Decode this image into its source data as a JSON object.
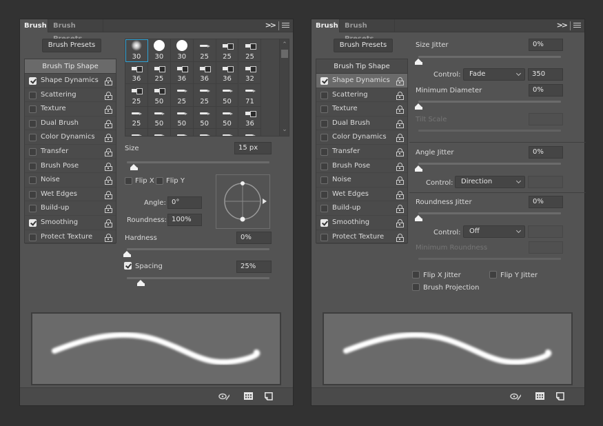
{
  "panels": [
    {
      "id": "left",
      "tabs": [
        {
          "label": "Brush",
          "active": true
        },
        {
          "label": "Brush Presets",
          "active": false
        }
      ],
      "collapse_icon": "double-chevron-right-icon",
      "menu_icon": "hamburger-menu-icon",
      "presets_button": "Brush Presets",
      "options_header": "Brush Tip Shape",
      "options_header_selected": true,
      "options": [
        {
          "label": "Shape Dynamics",
          "checked": true,
          "selected": false
        },
        {
          "label": "Scattering",
          "checked": false,
          "selected": false
        },
        {
          "label": "Texture",
          "checked": false,
          "selected": false
        },
        {
          "label": "Dual Brush",
          "checked": false,
          "selected": false
        },
        {
          "label": "Color Dynamics",
          "checked": false,
          "selected": false
        },
        {
          "label": "Transfer",
          "checked": false,
          "selected": false
        },
        {
          "label": "Brush Pose",
          "checked": false,
          "selected": false
        },
        {
          "label": "Noise",
          "checked": false,
          "selected": false
        },
        {
          "label": "Wet Edges",
          "checked": false,
          "selected": false
        },
        {
          "label": "Build-up",
          "checked": false,
          "selected": false
        },
        {
          "label": "Smoothing",
          "checked": true,
          "selected": false
        },
        {
          "label": "Protect Texture",
          "checked": false,
          "selected": false
        }
      ],
      "brush_tips": [
        {
          "size": "30",
          "kind": "soft",
          "selected": true
        },
        {
          "size": "30",
          "kind": "hard"
        },
        {
          "size": "30",
          "kind": "hard"
        },
        {
          "size": "25",
          "kind": "pen"
        },
        {
          "size": "25",
          "kind": "tool"
        },
        {
          "size": "25",
          "kind": "tool"
        },
        {
          "size": "36",
          "kind": "tool"
        },
        {
          "size": "25",
          "kind": "tool"
        },
        {
          "size": "36",
          "kind": "tool"
        },
        {
          "size": "36",
          "kind": "tool"
        },
        {
          "size": "36",
          "kind": "tool"
        },
        {
          "size": "32",
          "kind": "tool"
        },
        {
          "size": "25",
          "kind": "tool"
        },
        {
          "size": "50",
          "kind": "tool"
        },
        {
          "size": "25",
          "kind": "pen"
        },
        {
          "size": "25",
          "kind": "pen"
        },
        {
          "size": "50",
          "kind": "pen"
        },
        {
          "size": "71",
          "kind": "pen"
        },
        {
          "size": "25",
          "kind": "pen"
        },
        {
          "size": "50",
          "kind": "pen"
        },
        {
          "size": "50",
          "kind": "pen"
        },
        {
          "size": "50",
          "kind": "pen"
        },
        {
          "size": "50",
          "kind": "pen"
        },
        {
          "size": "36",
          "kind": "tool"
        }
      ],
      "tip_shape": {
        "size_label": "Size",
        "size_value": "15 px",
        "size_fraction": 0.05,
        "flip_x_label": "Flip X",
        "flip_x": false,
        "flip_y_label": "Flip Y",
        "flip_y": false,
        "angle_label": "Angle:",
        "angle_value": "0°",
        "roundness_label": "Roundness:",
        "roundness_value": "100%",
        "hardness_label": "Hardness",
        "hardness_value": "0%",
        "hardness_fraction": 0.0,
        "spacing_label": "Spacing",
        "spacing_checked": true,
        "spacing_value": "25%",
        "spacing_fraction": 0.1
      },
      "footer_icons": [
        "toggle-brush-preview-icon",
        "brush-grid-icon",
        "create-new-brush-icon"
      ]
    },
    {
      "id": "right",
      "tabs": [
        {
          "label": "Brush",
          "active": true
        },
        {
          "label": "Brush Presets",
          "active": false
        }
      ],
      "collapse_icon": "double-chevron-right-icon",
      "menu_icon": "hamburger-menu-icon",
      "presets_button": "Brush Presets",
      "options_header": "Brush Tip Shape",
      "options_header_selected": false,
      "options": [
        {
          "label": "Shape Dynamics",
          "checked": true,
          "selected": true
        },
        {
          "label": "Scattering",
          "checked": false,
          "selected": false
        },
        {
          "label": "Texture",
          "checked": false,
          "selected": false
        },
        {
          "label": "Dual Brush",
          "checked": false,
          "selected": false
        },
        {
          "label": "Color Dynamics",
          "checked": false,
          "selected": false
        },
        {
          "label": "Transfer",
          "checked": false,
          "selected": false
        },
        {
          "label": "Brush Pose",
          "checked": false,
          "selected": false
        },
        {
          "label": "Noise",
          "checked": false,
          "selected": false
        },
        {
          "label": "Wet Edges",
          "checked": false,
          "selected": false
        },
        {
          "label": "Build-up",
          "checked": false,
          "selected": false
        },
        {
          "label": "Smoothing",
          "checked": true,
          "selected": false
        },
        {
          "label": "Protect Texture",
          "checked": false,
          "selected": false
        }
      ],
      "shape_dynamics": {
        "size_jitter_label": "Size Jitter",
        "size_jitter_value": "0%",
        "size_jitter_fraction": 0.0,
        "size_control_label": "Control:",
        "size_control_value": "Fade",
        "size_control_steps": "350",
        "min_diameter_label": "Minimum Diameter",
        "min_diameter_value": "0%",
        "min_diameter_fraction": 0.0,
        "tilt_scale_label": "Tilt Scale",
        "tilt_scale_value": "",
        "angle_jitter_label": "Angle Jitter",
        "angle_jitter_value": "0%",
        "angle_jitter_fraction": 0.0,
        "angle_control_label": "Control:",
        "angle_control_value": "Direction",
        "angle_control_extra": "",
        "roundness_jitter_label": "Roundness Jitter",
        "roundness_jitter_value": "0%",
        "roundness_jitter_fraction": 0.0,
        "roundness_control_label": "Control:",
        "roundness_control_value": "Off",
        "roundness_control_extra": "",
        "min_roundness_label": "Minimum Roundness",
        "min_roundness_value": "",
        "flip_x_jitter_label": "Flip X Jitter",
        "flip_x_jitter": false,
        "flip_y_jitter_label": "Flip Y Jitter",
        "flip_y_jitter": false,
        "brush_projection_label": "Brush Projection",
        "brush_projection": false
      },
      "footer_icons": [
        "toggle-brush-preview-icon",
        "brush-grid-icon",
        "create-new-brush-icon"
      ]
    }
  ],
  "colors": {
    "background": "#323232",
    "panel": "#535353",
    "selection_outline": "#2ea3d6",
    "preview_bg": "#6a6a6a",
    "stroke": "#ffffff"
  }
}
